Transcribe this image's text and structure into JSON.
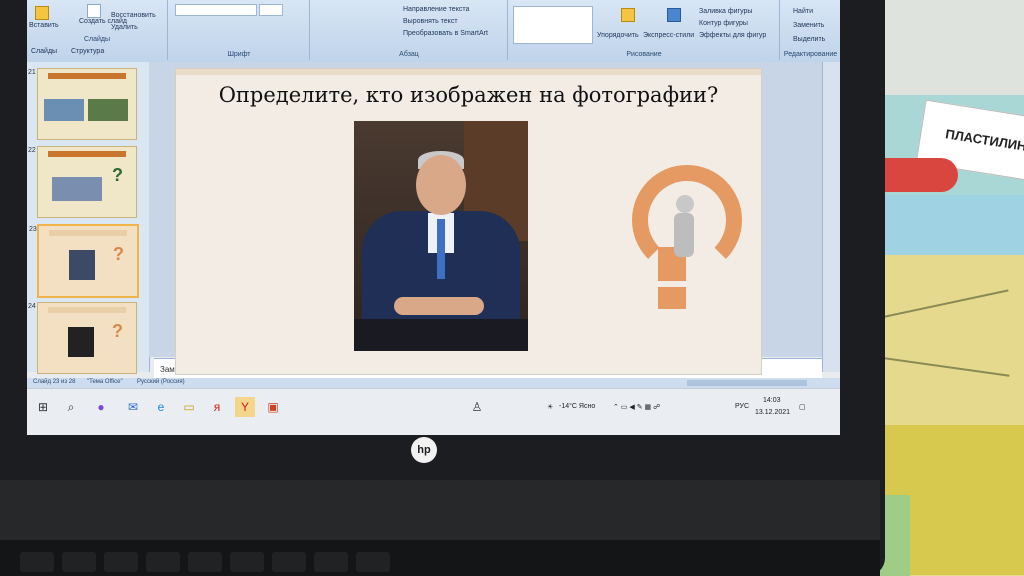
{
  "ribbon": {
    "create_slide": "Создать слайд",
    "restore": "Восстановить",
    "delete": "Удалить",
    "slides_group": "Слайды",
    "font_group": "Шрифт",
    "paragraph_group": "Абзац",
    "text_direction": "Направление текста",
    "align_text": "Выровнять текст",
    "convert_smartart": "Преобразовать в SmartArt",
    "drawing_group": "Рисование",
    "arrange": "Упорядочить",
    "quick_styles": "Экспресс-стили",
    "shape_fill": "Заливка фигуры",
    "shape_outline": "Контур фигуры",
    "shape_effects": "Эффекты для фигур",
    "find": "Найти",
    "replace": "Заменить",
    "select": "Выделить",
    "editing_group": "Редактирование",
    "paste": "Вставить"
  },
  "tabs": {
    "slides": "Слайды",
    "outline": "Структура"
  },
  "thumbnails": [
    {
      "num": "21"
    },
    {
      "num": "22"
    },
    {
      "num": "23"
    },
    {
      "num": "24"
    }
  ],
  "slide": {
    "title": "Определите, кто изображен на фотографии?"
  },
  "notes": {
    "placeholder": "Заметки к слайду"
  },
  "status": {
    "slide_count": "Слайд 23 из 28",
    "theme": "\"Тема Office\"",
    "language": "Русский (Россия)"
  },
  "taskbar": {
    "weather": "-14°C Ясно",
    "lang": "РУС",
    "time": "14:03",
    "date": "13.12.2021"
  },
  "laptop": {
    "brand": "hp"
  },
  "book": {
    "title": "ПЛАСТИЛИН"
  }
}
